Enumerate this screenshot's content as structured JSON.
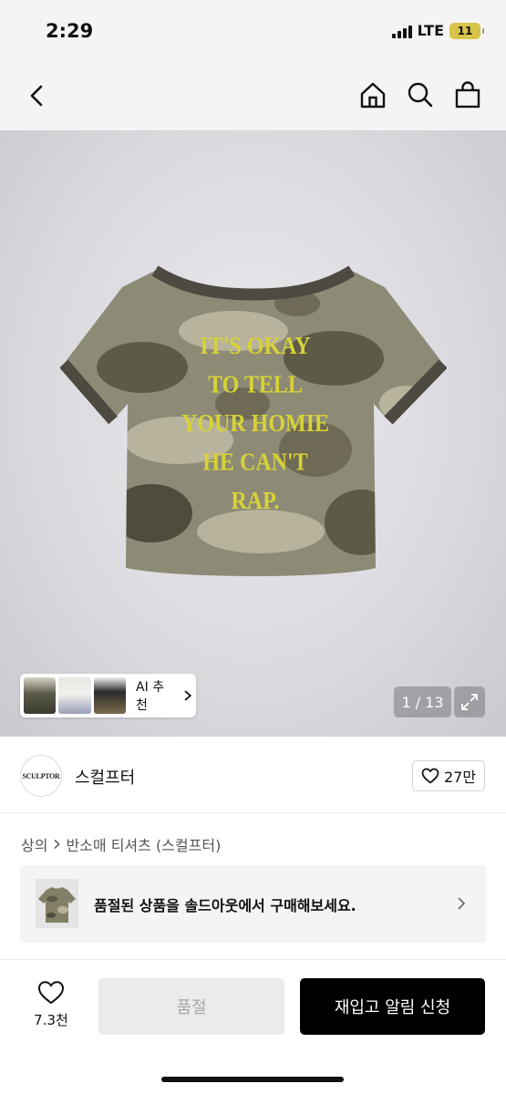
{
  "status_bar": {
    "time": "2:29",
    "network": "LTE",
    "battery": "11"
  },
  "nav": {
    "back_icon": "chevron-left-icon",
    "icons": [
      "home-icon",
      "search-icon",
      "shopping-bag-icon"
    ]
  },
  "product_image": {
    "print_lines": [
      "IT'S OKAY",
      "TO TELL",
      "YOUR HOMIE",
      "HE CAN'T",
      "RAP."
    ],
    "ai_recommend_label": "AI 추천",
    "page_counter": "1 / 13",
    "colors": {
      "shirt_base": "#8d8b76",
      "ringer": "#4e4a42",
      "print": "#d8d236"
    }
  },
  "brand": {
    "logo_text": "SCULPTOR",
    "name": "스컬프터",
    "like_count": "27만"
  },
  "category": {
    "parent": "상의",
    "current": "반소매 티셔츠 (스컬프터)"
  },
  "soldout_banner": {
    "text": "품절된 상품을 솔드아웃에서 구매해보세요."
  },
  "bottom_bar": {
    "wish_count": "7.3천",
    "soldout_label": "품절",
    "restock_label": "재입고 알림 신청"
  }
}
